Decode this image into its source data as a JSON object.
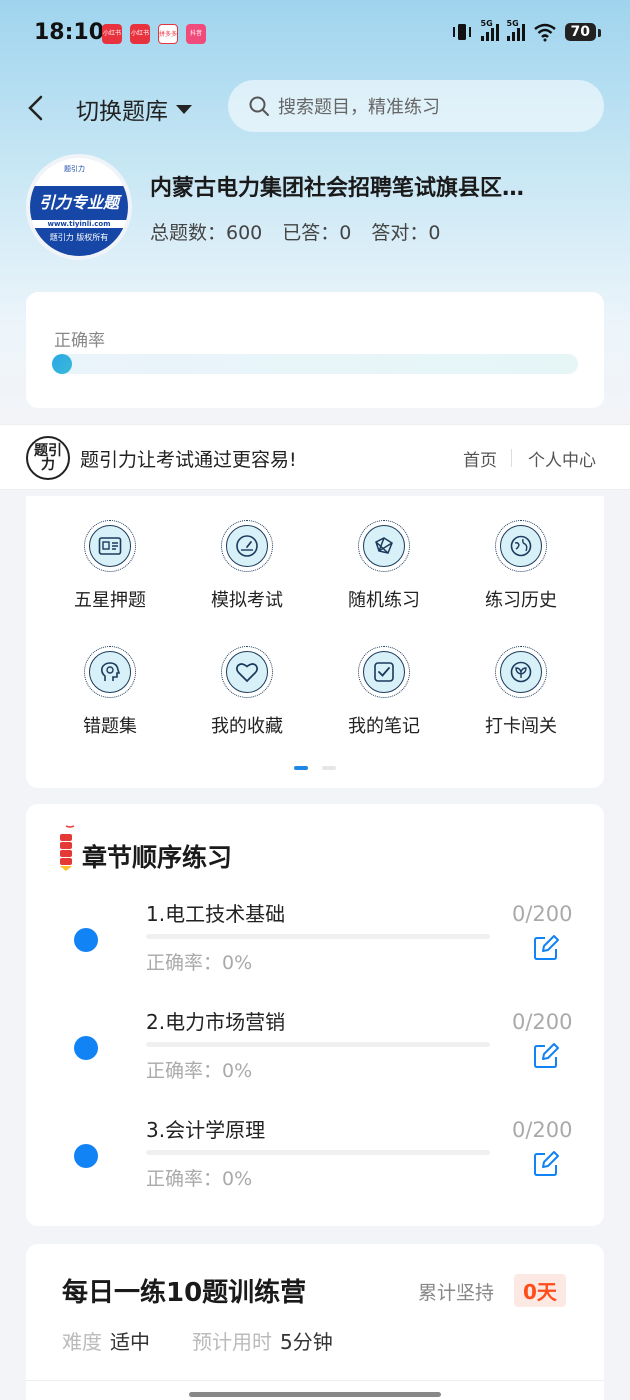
{
  "status_bar": {
    "time": "18:10",
    "network_a": "5G",
    "network_b": "5G",
    "battery": "70",
    "app_badges": [
      "小红书",
      "小红书",
      "拼多多",
      "抖音"
    ]
  },
  "header": {
    "switch_label": "切换题库",
    "search_placeholder": "搜索题目，精准练习"
  },
  "bank": {
    "logo_text": "引力专业题",
    "logo_url": "www.tiyinli.com",
    "logo_footer": "题引力 版权所有",
    "logo_mark": "题引力",
    "title": "内蒙古电力集团社会招聘笔试旗县区…",
    "total_label": "总题数：600",
    "answered_label": "已答：0",
    "correct_label": "答对：0"
  },
  "accuracy": {
    "label": "正确率",
    "value": 0
  },
  "promo": {
    "logo_text": "题引力",
    "slogan": "题引力让考试通过更容易!",
    "home": "首页",
    "personal_center": "个人中心"
  },
  "features": [
    {
      "label": "五星押题",
      "icon": "id-card-icon"
    },
    {
      "label": "模拟考试",
      "icon": "gauge-icon"
    },
    {
      "label": "随机练习",
      "icon": "network-icon"
    },
    {
      "label": "练习历史",
      "icon": "globe-icon"
    },
    {
      "label": "错题集",
      "icon": "head-icon"
    },
    {
      "label": "我的收藏",
      "icon": "heart-icon"
    },
    {
      "label": "我的笔记",
      "icon": "note-icon"
    },
    {
      "label": "打卡闯关",
      "icon": "leaf-icon"
    }
  ],
  "chapter": {
    "title": "章节顺序练习",
    "items": [
      {
        "name": "1.电工技术基础",
        "accuracy": "正确率：0%",
        "count": "0/200"
      },
      {
        "name": "2.电力市场营销",
        "accuracy": "正确率：0%",
        "count": "0/200"
      },
      {
        "name": "3.会计学原理",
        "accuracy": "正确率：0%",
        "count": "0/200"
      }
    ]
  },
  "daily": {
    "title": "每日一练10题训练营",
    "keep_label": "累计坚持",
    "days": "0天",
    "difficulty_label": "难度",
    "difficulty_value": "适中",
    "time_label": "预计用时",
    "time_value": "5分钟"
  },
  "colors": {
    "accent": "#1283f5",
    "highlight": "#ff4d1a"
  }
}
